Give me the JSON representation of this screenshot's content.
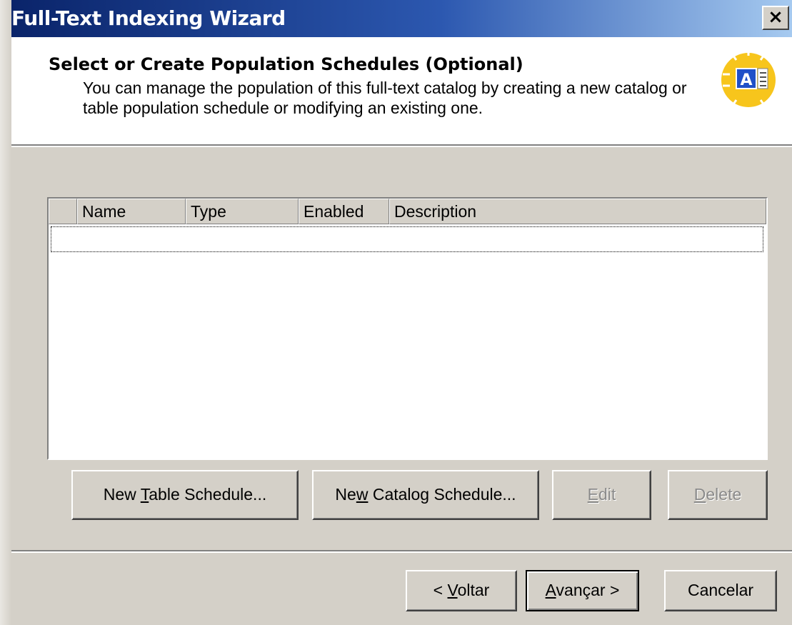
{
  "window": {
    "title": "Full-Text Indexing Wizard",
    "close_label": "×"
  },
  "header": {
    "title": "Select or Create Population Schedules (Optional)",
    "description": "You can manage the population of this full-text catalog by creating a new catalog or table population schedule or modifying an existing one.",
    "icon_letter": "A"
  },
  "schedules_list": {
    "columns": [
      "",
      "Name",
      "Type",
      "Enabled",
      "Description"
    ],
    "rows": []
  },
  "actions": {
    "new_table_schedule": {
      "pre": "New ",
      "accel": "T",
      "post": "able Schedule..."
    },
    "new_catalog_schedule": {
      "pre": "Ne",
      "accel": "w",
      "post": " Catalog Schedule..."
    },
    "edit": {
      "pre": "",
      "accel": "E",
      "post": "dit"
    },
    "delete": {
      "pre": "",
      "accel": "D",
      "post": "elete"
    }
  },
  "nav": {
    "back": {
      "pre": "< ",
      "accel": "V",
      "post": "oltar"
    },
    "next": {
      "pre": "",
      "accel": "A",
      "post": "vançar >"
    },
    "cancel": {
      "label": "Cancelar"
    }
  },
  "colors": {
    "face": "#d4d0c8",
    "title_start": "#0a246a",
    "title_end": "#a6caf0",
    "icon_yellow": "#f7c51c",
    "icon_blue": "#2050c8"
  }
}
